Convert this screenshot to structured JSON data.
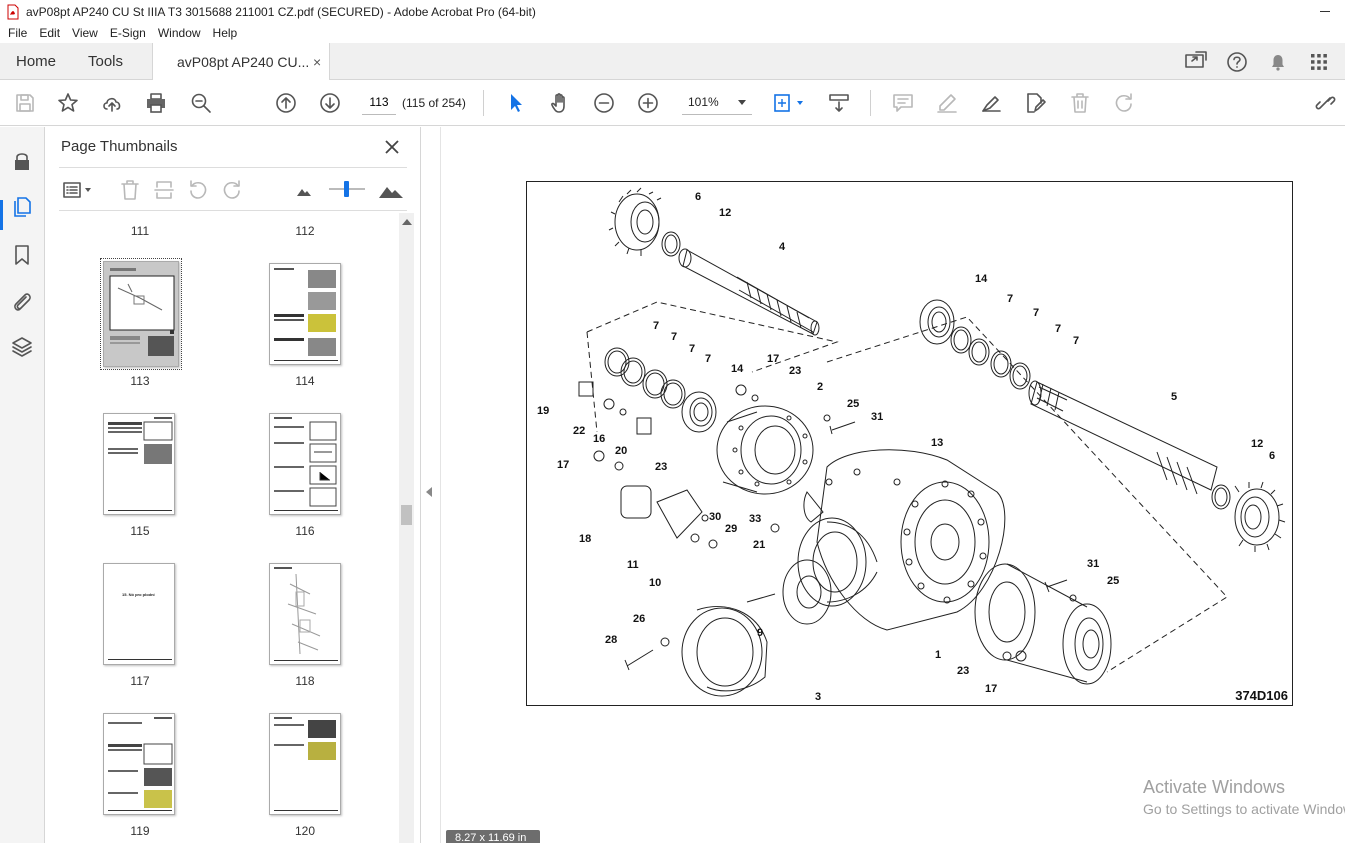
{
  "window": {
    "title": "avP08pt AP240 CU St IIIA T3 3015688 211001 CZ.pdf (SECURED) - Adobe Acrobat Pro (64-bit)"
  },
  "menu": [
    "File",
    "Edit",
    "View",
    "E-Sign",
    "Window",
    "Help"
  ],
  "tabs": {
    "home": "Home",
    "tools": "Tools",
    "document": "avP08pt AP240 CU...",
    "close_glyph": "×"
  },
  "toolbar": {
    "page_number": "113",
    "page_count": "(115 of 254)",
    "zoom": "101%"
  },
  "thumbnails_panel": {
    "title": "Page Thumbnails",
    "pages": [
      {
        "label": "111",
        "selected": false
      },
      {
        "label": "112",
        "selected": false
      },
      {
        "label": "113",
        "selected": true
      },
      {
        "label": "114",
        "selected": false
      },
      {
        "label": "115",
        "selected": false
      },
      {
        "label": "116",
        "selected": false
      },
      {
        "label": "117",
        "selected": false
      },
      {
        "label": "118",
        "selected": false
      },
      {
        "label": "119",
        "selected": false
      },
      {
        "label": "120",
        "selected": false
      }
    ],
    "thumb_117_text": "15.   Nó pro plodní"
  },
  "document": {
    "figure_code": "374D106",
    "callouts": [
      "6",
      "12",
      "4",
      "14",
      "7",
      "7",
      "7",
      "7",
      "7",
      "7",
      "7",
      "7",
      "14",
      "17",
      "23",
      "2",
      "19",
      "22",
      "16",
      "20",
      "25",
      "31",
      "5",
      "12",
      "6",
      "13",
      "17",
      "23",
      "18",
      "30",
      "29",
      "33",
      "21",
      "11",
      "10",
      "9",
      "26",
      "28",
      "3",
      "31",
      "25",
      "1",
      "23",
      "17"
    ],
    "page_size": "8.27 x 11.69 in"
  },
  "watermark": {
    "title": "Activate Windows",
    "subtitle": "Go to Settings to activate Windows."
  }
}
